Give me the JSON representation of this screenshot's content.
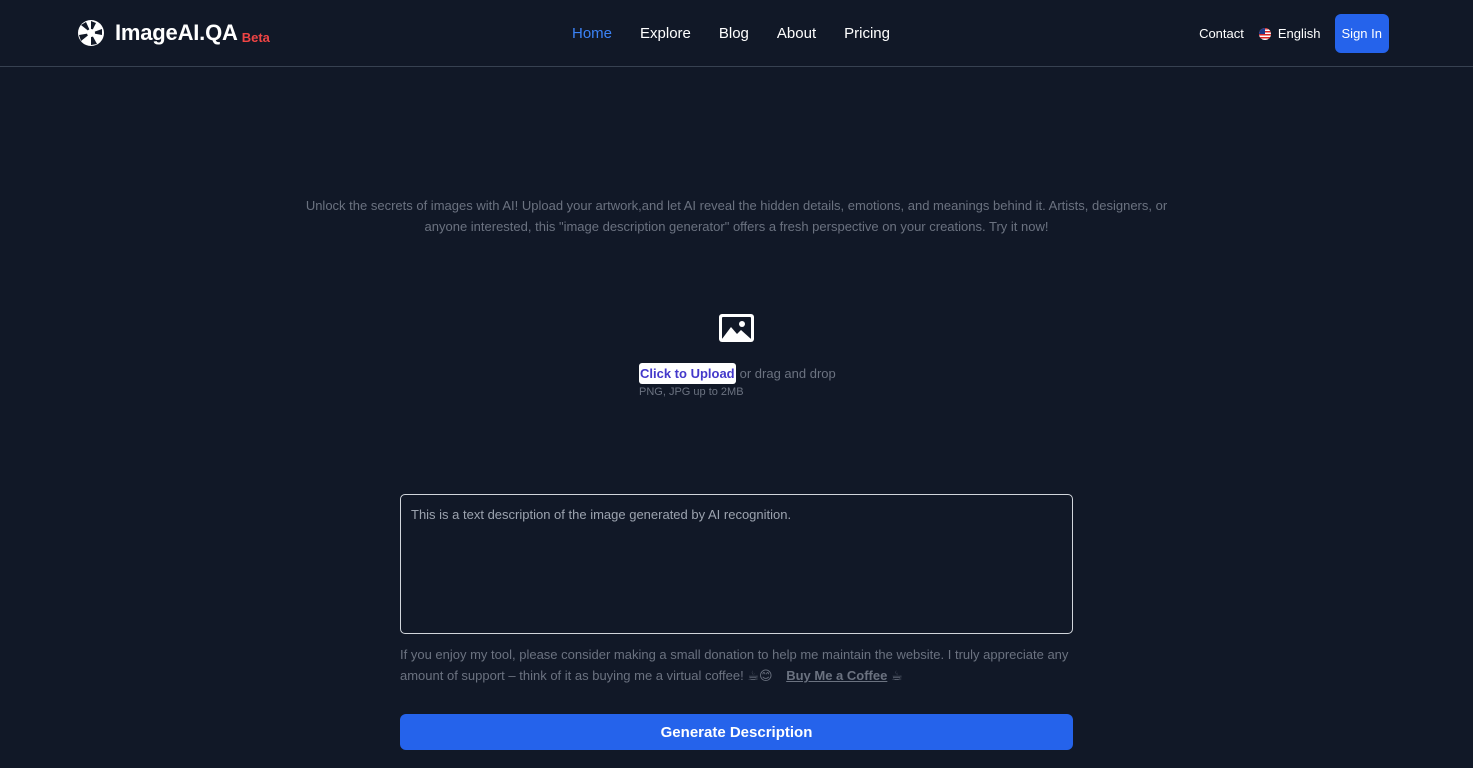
{
  "header": {
    "logo_text": "ImageAI.QA",
    "logo_badge": "Beta",
    "nav": [
      {
        "label": "Home",
        "active": true
      },
      {
        "label": "Explore",
        "active": false
      },
      {
        "label": "Blog",
        "active": false
      },
      {
        "label": "About",
        "active": false
      },
      {
        "label": "Pricing",
        "active": false
      }
    ],
    "contact_label": "Contact",
    "language_label": "English",
    "signin_label": "Sign In"
  },
  "intro": {
    "text": "Unlock the secrets of images with AI! Upload your artwork,and let AI reveal the hidden details, emotions, and meanings behind it. Artists, designers, or anyone interested, this \"image description generator\" offers a fresh perspective on your creations. Try it now!"
  },
  "upload": {
    "icon": "image-icon",
    "button_label": "Click to Upload",
    "drag_text": "or drag and drop",
    "hint": "PNG, JPG up to 2MB"
  },
  "result": {
    "placeholder": "This is a text description of the image generated by AI recognition."
  },
  "donation": {
    "text": "If you enjoy my tool, please consider making a small donation to help me maintain the website. I truly appreciate any amount of support – think of it as buying me a virtual coffee! ☕😊",
    "link_label": "Buy Me a Coffee",
    "link_emoji": "☕"
  },
  "actions": {
    "generate_label": "Generate Description"
  },
  "colors": {
    "background": "#111827",
    "accent": "#2563eb",
    "nav_active": "#3b82f6",
    "badge": "#ef4444"
  }
}
